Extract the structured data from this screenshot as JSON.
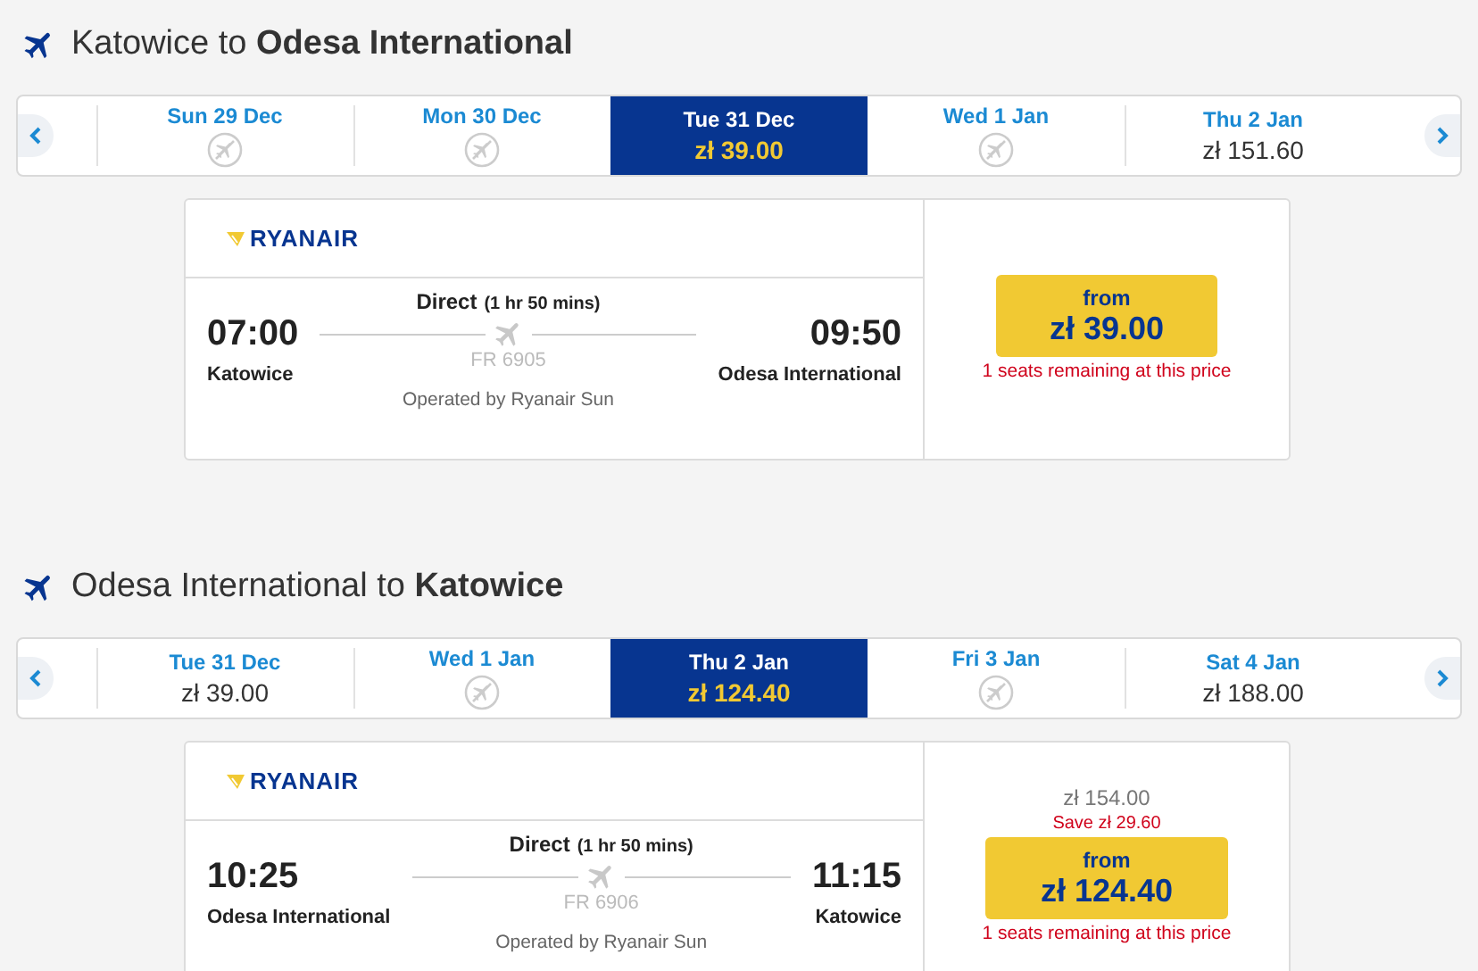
{
  "journeys": [
    {
      "heading": "Katowice to **Odesa International**",
      "days": [
        {
          "date": "Sun 29 Dec",
          "kind": "no-flight",
          "selected": false
        },
        {
          "date": "Mon 30 Dec",
          "kind": "no-flight",
          "selected": false
        },
        {
          "date": "Tue 31 Dec",
          "kind": "price",
          "price": "zł 39.00",
          "selected": true
        },
        {
          "date": "Wed 1 Jan",
          "kind": "no-flight",
          "selected": false
        },
        {
          "date": "Thu 2 Jan",
          "kind": "price",
          "price": "zł 151.60",
          "selected": false
        }
      ],
      "flight": {
        "airline": "RYANAIR",
        "stops": "Direct",
        "duration": "(1 hr 50 mins)",
        "depart_time": "07:00",
        "depart_airport": "Katowice",
        "arrive_time": "09:50",
        "arrive_airport": "Odesa International",
        "flight_number": "FR 6905",
        "operated_by": "Operated by Ryanair Sun"
      },
      "fare": {
        "from_label": "from",
        "price": "zł 39.00",
        "seats_note": "1 seats remaining at this price"
      }
    },
    {
      "heading": "Odesa International to **Katowice**",
      "days": [
        {
          "date": "Tue 31 Dec",
          "kind": "price",
          "price": "zł 39.00",
          "selected": false
        },
        {
          "date": "Wed 1 Jan",
          "kind": "no-flight",
          "selected": false
        },
        {
          "date": "Thu 2 Jan",
          "kind": "price",
          "price": "zł 124.40",
          "selected": true
        },
        {
          "date": "Fri 3 Jan",
          "kind": "no-flight",
          "selected": false
        },
        {
          "date": "Sat 4 Jan",
          "kind": "price",
          "price": "zł 188.00",
          "selected": false
        }
      ],
      "flight": {
        "airline": "RYANAIR",
        "stops": "Direct",
        "duration": "(1 hr 50 mins)",
        "depart_time": "10:25",
        "depart_airport": "Odesa International",
        "arrive_time": "11:15",
        "arrive_airport": "Katowice",
        "flight_number": "FR 6906",
        "operated_by": "Operated by Ryanair Sun"
      },
      "fare": {
        "original_price": "zł 154.00",
        "save_label": "Save",
        "save_amount": "zł 29.60",
        "from_label": "from",
        "price": "zł 124.40",
        "seats_note": "1 seats remaining at this price"
      }
    }
  ]
}
